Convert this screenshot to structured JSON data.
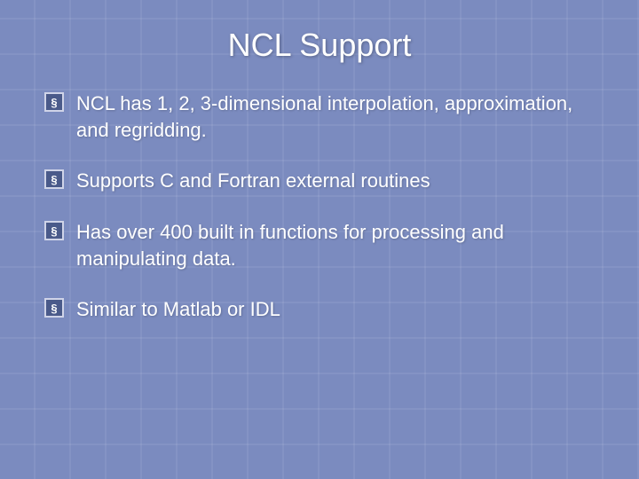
{
  "slide": {
    "title": "NCL Support",
    "bullets": [
      {
        "id": "bullet-1",
        "text": "NCL has 1, 2, 3-dimensional interpolation, approximation, and regridding."
      },
      {
        "id": "bullet-2",
        "text": "Supports C and Fortran external routines"
      },
      {
        "id": "bullet-3",
        "text": "Has over 400 built in functions for processing and manipulating data."
      },
      {
        "id": "bullet-4",
        "text": "Similar to Matlab or IDL"
      }
    ]
  }
}
